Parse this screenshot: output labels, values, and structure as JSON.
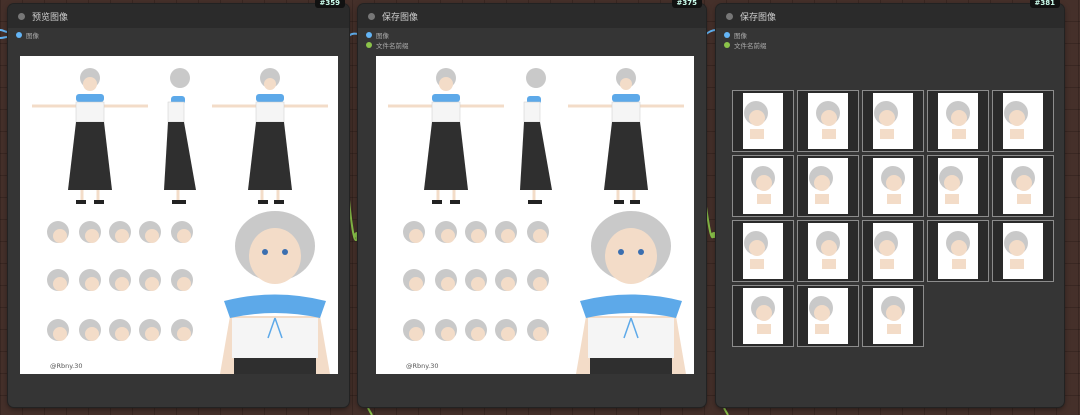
{
  "nodes": [
    {
      "id": "#359",
      "title": "预览图像",
      "inputs": [
        {
          "label": "图像",
          "type": "image"
        }
      ],
      "signature": "@Rbny.30"
    },
    {
      "id": "#375",
      "title": "保存图像",
      "inputs": [
        {
          "label": "图像",
          "type": "image"
        },
        {
          "label": "文件名前缀",
          "type": "text"
        }
      ],
      "signature": "@Rbny.30"
    },
    {
      "id": "#381",
      "title": "保存图像",
      "inputs": [
        {
          "label": "图像",
          "type": "image"
        },
        {
          "label": "文件名前缀",
          "type": "text"
        }
      ],
      "thumbnail_count": 18
    }
  ],
  "colors": {
    "image_socket": "#64b5f6",
    "text_socket": "#8bc34a",
    "node_bg": "#353535",
    "canvas": "#45302a"
  },
  "icons": [
    "node-status-dot-icon",
    "input-socket-icon"
  ]
}
